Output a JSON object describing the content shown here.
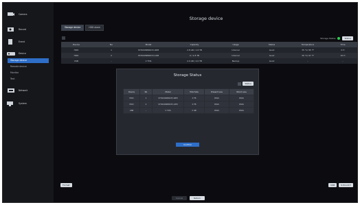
{
  "sidebar": {
    "items": [
      {
        "label": "Camera",
        "icon": "camera-icon"
      },
      {
        "label": "Record",
        "icon": "record-icon"
      },
      {
        "label": "Event",
        "icon": "event-icon"
      },
      {
        "label": "Device",
        "icon": "device-icon"
      },
      {
        "label": "Network",
        "icon": "network-icon"
      },
      {
        "label": "System",
        "icon": "system-icon"
      }
    ],
    "sub_items": [
      "Storage device",
      "Remote device",
      "Monitor",
      "Text"
    ]
  },
  "main": {
    "title": "Storage device",
    "tabs": [
      "Storage device",
      "HDD alarm"
    ],
    "storage_status_label": "Storage Status",
    "status_color": "#2bd14e",
    "status_button": "Status",
    "table": {
      "headers": [
        "Device",
        "",
        "No",
        "Model",
        "Capacity",
        "Usage",
        "Status",
        "Temperature",
        "Time"
      ],
      "rows": [
        [
          "HDD",
          "",
          "1",
          "ST3000NM0033-9ZM",
          "2.8 GB / 1.8 TB",
          "Internal",
          "Good",
          "35 °C/ 95 °F",
          "0 H"
        ],
        [
          "HDD",
          "",
          "2",
          "ST3000NM0033-1ZM",
          "0 / 2.8 TB",
          "Internal",
          "Good",
          "36 °C/ 97 °F",
          "20 H"
        ],
        [
          "USB",
          "",
          "–",
          "V TOS",
          "2.0 GB / 2.0 TB",
          "Backup",
          "Good",
          "–",
          "–"
        ]
      ]
    },
    "format_button": "Format",
    "right_buttons": [
      "USB",
      "S.M.A.R.T."
    ],
    "cancel_button": "Cancel",
    "return_button": "Return"
  },
  "modal": {
    "title": "Storage Status",
    "button": "Status",
    "table": {
      "headers": [
        "Device",
        "No",
        "Model",
        "Total Size",
        "Present Loss",
        "Worst Loss"
      ],
      "rows": [
        [
          "HDD",
          "1",
          "ST3000NM0033-9ZM",
          "2 TB",
          "PASS",
          "PASS"
        ],
        [
          "HDD",
          "2",
          "ST3000NM0033-1ZM",
          "2 TB",
          "PASS",
          "PASS"
        ],
        [
          "USB",
          "–",
          "V TOS",
          "2 GB",
          "PASS",
          "PASS"
        ]
      ]
    },
    "confirm": "Confirm"
  }
}
